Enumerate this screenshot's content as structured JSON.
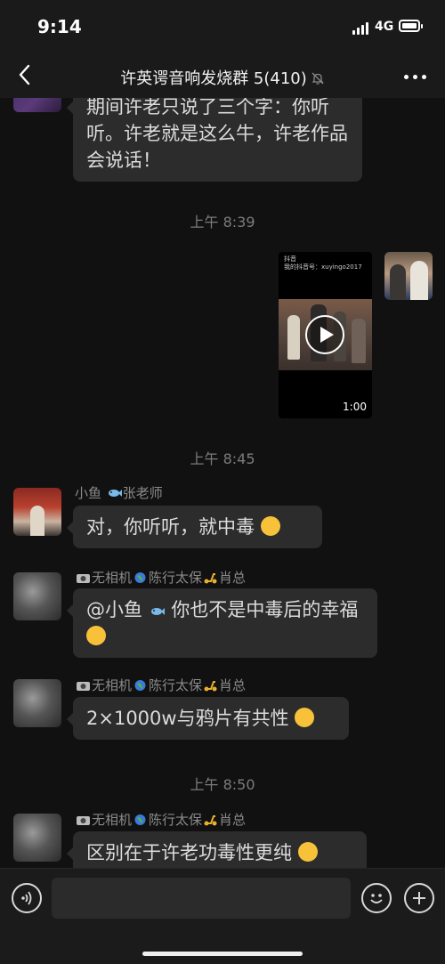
{
  "status": {
    "time": "9:14",
    "network": "4G"
  },
  "header": {
    "title": "许英谔音响发烧群 5(410)"
  },
  "messages": {
    "m1_text": "期间许老只说了三个字：你听听。许老就是这么牛，许老作品会说话！",
    "ts1": "上午 8:39",
    "video": {
      "platform": "抖音",
      "account": "我的抖音号：xuyingo2017",
      "duration": "1:00"
    },
    "ts2": "上午 8:45",
    "m3": {
      "sender_a": "小鱼 ",
      "sender_b": "张老师",
      "text": "对，你听听，就中毒"
    },
    "m4": {
      "sender_a": "无相机",
      "sender_b": "陈行太保",
      "sender_c": "肖总",
      "text_a": "@小鱼 ",
      "text_b": " 你也不是中毒后的幸福"
    },
    "m5": {
      "sender_a": "无相机",
      "sender_b": "陈行太保",
      "sender_c": "肖总",
      "text": "2×1000w与鸦片有共性"
    },
    "ts3": "上午 8:50",
    "m6": {
      "sender_a": "无相机",
      "sender_b": "陈行太保",
      "sender_c": "肖总",
      "text": "区别在于许老功毒性更纯"
    }
  },
  "input": {
    "placeholder": ""
  },
  "icons": {
    "back": "chevron-left-icon",
    "mute": "bell-off-icon",
    "more": "more-dots-icon",
    "voice": "voice-icon",
    "emoji": "emoji-icon",
    "plus": "plus-icon"
  }
}
